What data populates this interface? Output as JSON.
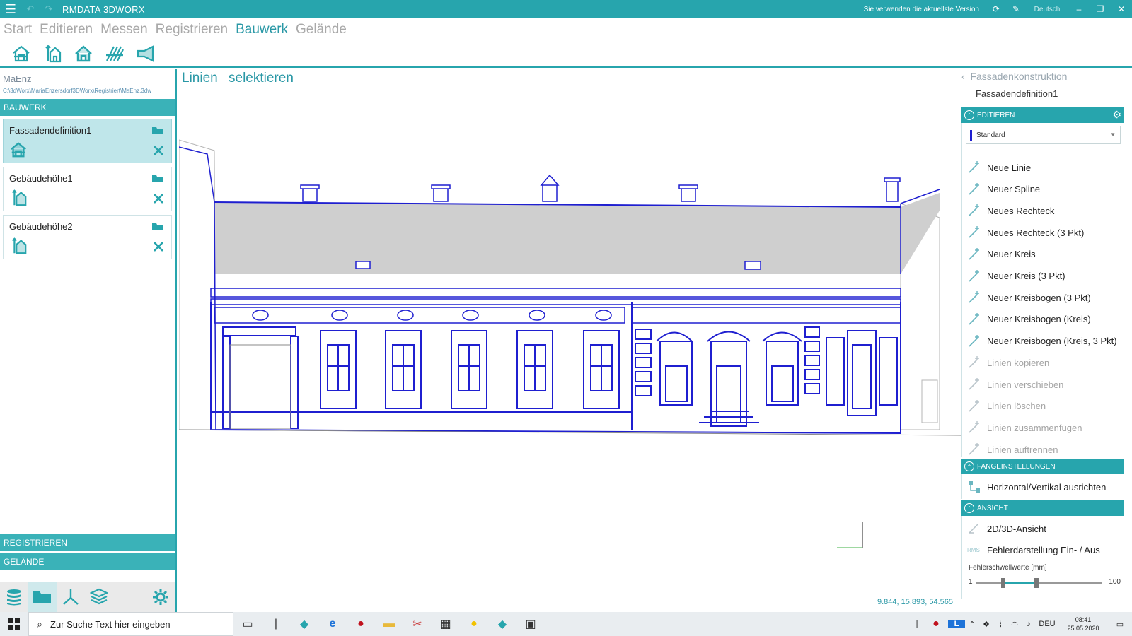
{
  "app": {
    "title": "RMDATA 3DWORX",
    "update_status": "Sie verwenden die aktuellste Version",
    "language": "Deutsch"
  },
  "menu": [
    "Start",
    "Editieren",
    "Messen",
    "Registrieren",
    "Bauwerk",
    "Gelände"
  ],
  "active_menu": "Bauwerk",
  "ribbon_icons": [
    "facade-house-icon",
    "building-height-icon",
    "house-outline-icon",
    "hatch-lines-icon",
    "projector-icon"
  ],
  "left": {
    "project_name": "MaEnz",
    "project_path": "C:\\3dWorx\\MariaEnzersdorf3DWorx\\Registriert\\MaEnz.3dw",
    "section_bauwerk": "BAUWERK",
    "cards": [
      {
        "label": "Fassadendefinition1",
        "icon": "facade-house-icon",
        "selected": true
      },
      {
        "label": "Gebäudehöhe1",
        "icon": "building-height-icon",
        "selected": false
      },
      {
        "label": "Gebäudehöhe2",
        "icon": "building-height-icon",
        "selected": false
      }
    ],
    "section_registrieren": "REGISTRIEREN",
    "section_gelaende": "GELÄNDE",
    "bottom_icons": [
      "database-icon",
      "folder-open-icon",
      "axes-icon",
      "layers-icon",
      "gear-icon"
    ]
  },
  "canvas": {
    "title_part1": "Linien",
    "title_part2": "selektieren",
    "coords": "9.844, 15.893, 54.565"
  },
  "right": {
    "back_label": "Fassadenkonstruktion",
    "subtitle": "Fassadendefinition1",
    "section_edit": "EDITIEREN",
    "select_value": "Standard",
    "select_color": "#1f1fd0",
    "edit_items": [
      {
        "label": "Neue Linie",
        "enabled": true
      },
      {
        "label": "Neuer Spline",
        "enabled": true
      },
      {
        "label": "Neues Rechteck",
        "enabled": true
      },
      {
        "label": "Neues Rechteck (3 Pkt)",
        "enabled": true
      },
      {
        "label": "Neuer Kreis",
        "enabled": true
      },
      {
        "label": "Neuer Kreis (3 Pkt)",
        "enabled": true
      },
      {
        "label": "Neuer Kreisbogen (3 Pkt)",
        "enabled": true
      },
      {
        "label": "Neuer Kreisbogen (Kreis)",
        "enabled": true
      },
      {
        "label": "Neuer Kreisbogen (Kreis, 3 Pkt)",
        "enabled": true
      },
      {
        "label": "Linien kopieren",
        "enabled": false
      },
      {
        "label": "Linien verschieben",
        "enabled": false
      },
      {
        "label": "Linien löschen",
        "enabled": false
      },
      {
        "label": "Linien zusammenfügen",
        "enabled": false
      },
      {
        "label": "Linien auftrennen",
        "enabled": false
      }
    ],
    "section_snap": "FANGEINSTELLUNGEN",
    "snap_item": "Horizontal/Vertikal ausrichten",
    "section_view": "ANSICHT",
    "view_items": [
      "2D/3D-Ansicht",
      "Fehlerdarstellung Ein- / Aus"
    ],
    "rms_label": "RMS",
    "threshold_label": "Fehlerschwellwerte [mm]",
    "slider_min": "1",
    "slider_max": "100",
    "slider_low_fraction": 0.22,
    "slider_high_fraction": 0.48
  },
  "taskbar": {
    "search_placeholder": "Zur Suche Text hier eingeben",
    "tray_lang": "DEU",
    "time": "08:41",
    "date": "25.05.2020"
  },
  "colors": {
    "accent": "#27a5ad",
    "line_blue": "#1f1fd0"
  }
}
